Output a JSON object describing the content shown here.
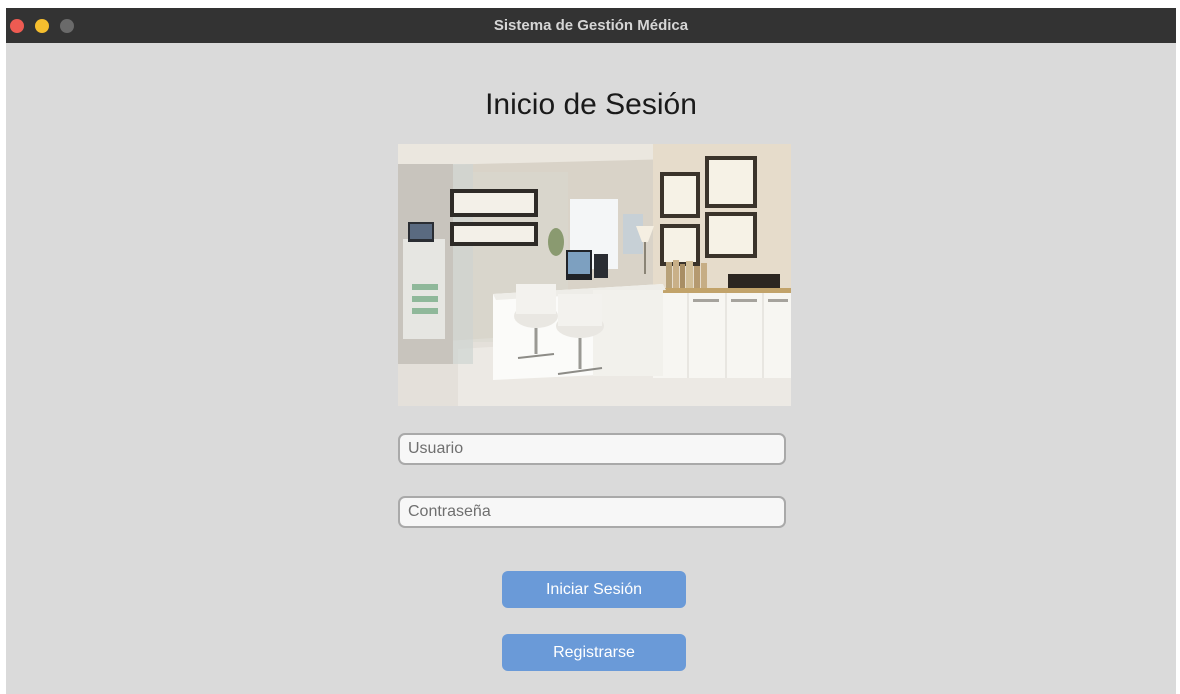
{
  "window": {
    "title": "Sistema de Gestión Médica",
    "controls": [
      "close",
      "minimize",
      "zoom"
    ]
  },
  "login": {
    "heading": "Inicio de Sesión",
    "image": {
      "subject": "medical-office-photo"
    },
    "username": {
      "placeholder": "Usuario",
      "value": ""
    },
    "password": {
      "placeholder": "Contraseña",
      "value": ""
    },
    "login_button": "Iniciar Sesión",
    "register_button": "Registrarse"
  },
  "colors": {
    "window_bg": "#dadada",
    "titlebar_bg": "#333333",
    "button_bg": "#6a9ad8",
    "close": "#ee5b52",
    "minimize": "#f5be2e",
    "zoom": "#6a6a6a"
  }
}
